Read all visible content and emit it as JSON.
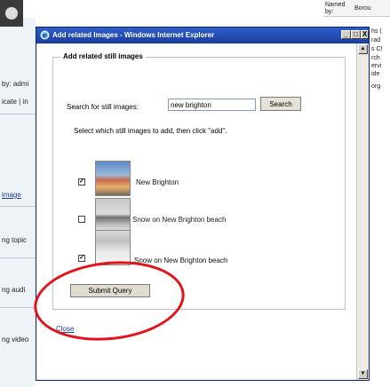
{
  "background": {
    "left_texts": [
      "by: admi",
      "icate | in",
      "image",
      "ng topic",
      "ng audi",
      "ng video"
    ],
    "right_top": [
      "Named",
      "by:",
      "Borou"
    ],
    "right_texts": [
      "hs (",
      "rad",
      "s Cl",
      "rch",
      "ervi",
      "ide",
      "org"
    ]
  },
  "window": {
    "title": "Add related Images - Windows Internet Explorer",
    "min_label": "_",
    "max_label": "□",
    "close_label": "X"
  },
  "form": {
    "legend": "Add related still images",
    "search_label": "Search for still images:",
    "search_value": "new brighton",
    "search_button": "Search",
    "instruction": "Select which still images to add, then click \"add\".",
    "images": [
      {
        "caption": "New Brighton",
        "checked": true
      },
      {
        "caption": "Snow on New Brighton beach",
        "checked": false
      },
      {
        "caption": "Snow on New Brighton beach",
        "checked": true
      }
    ],
    "submit_label": "Submit Query",
    "close_label": "Close"
  },
  "colors": {
    "annotation": "#e0141a",
    "titlebar": "#1b3e9c",
    "link": "#1a3d9c"
  }
}
